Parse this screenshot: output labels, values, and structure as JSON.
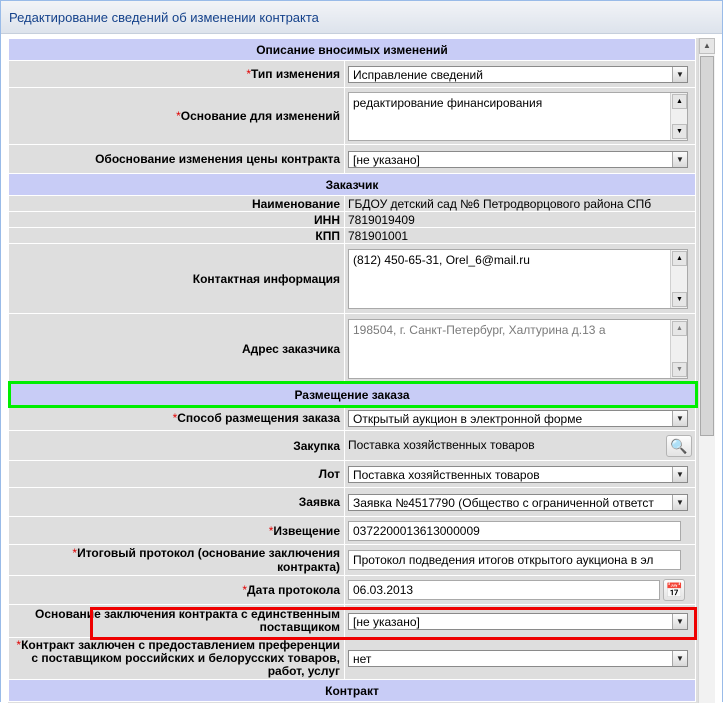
{
  "window": {
    "title": "Редактирование сведений об изменении контракта"
  },
  "sections": {
    "changes": "Описание вносимых изменений",
    "customer": "Заказчик",
    "placement": "Размещение заказа",
    "contract": "Контракт"
  },
  "changes": {
    "type_label": "Тип изменения",
    "type_value": "Исправление сведений",
    "basis_label": "Основание для изменений",
    "basis_value": "редактирование финансирования",
    "price_label": "Обоснование изменения цены контракта",
    "price_value": "[не указано]"
  },
  "customer": {
    "name_label": "Наименование",
    "name_value": "ГБДОУ детский сад №6 Петродворцового района СПб",
    "inn_label": "ИНН",
    "inn_value": "7819019409",
    "kpp_label": "КПП",
    "kpp_value": "781901001",
    "contact_label": "Контактная информация",
    "contact_value": "(812) 450-65-31, Orel_6@mail.ru",
    "address_label": "Адрес заказчика",
    "address_value": "198504, г. Санкт-Петербург, Халтурина д.13 а"
  },
  "placement": {
    "method_label": "Способ размещения заказа",
    "method_value": "Открытый аукцион в электронной форме",
    "purchase_label": "Закупка",
    "purchase_value": "Поставка хозяйственных товаров",
    "lot_label": "Лот",
    "lot_value": "Поставка хозяйственных товаров",
    "bid_label": "Заявка",
    "bid_value": "Заявка №4517790 (Общество с ограниченной ответст",
    "notice_label": "Извещение",
    "notice_value": "0372200013613000009",
    "protocol_label": "Итоговый протокол (основание заключения контракта)",
    "protocol_value": "Протокол подведения итогов открытого аукциона в эл",
    "date_label": "Дата протокола",
    "date_value": "06.03.2013",
    "single_label": "Основание заключения контракта с единственным поставщиком",
    "single_value": "[не указано]",
    "pref_label": "Контракт заключен с предоставлением преференции с поставщиком российских и белорусских товаров, работ, услуг",
    "pref_value": "нет"
  },
  "icons": {
    "dropdown": "▼",
    "up": "▲",
    "down": "▼",
    "search": "🔍",
    "calendar": "📅"
  }
}
